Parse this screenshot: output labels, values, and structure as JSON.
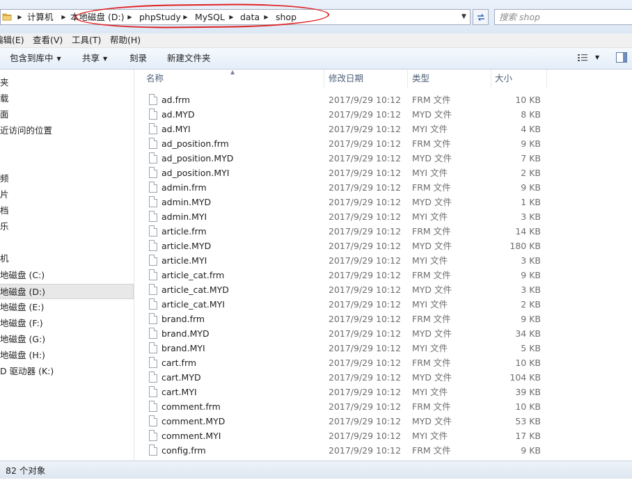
{
  "address_bar": {
    "crumbs": [
      "计算机",
      "本地磁盘 (D:)",
      "phpStudy",
      "MySQL",
      "data",
      "shop"
    ]
  },
  "search": {
    "placeholder": "搜索 shop"
  },
  "menu": [
    "编辑(E)",
    "查看(V)",
    "工具(T)",
    "帮助(H)"
  ],
  "toolbar": {
    "include_library": "包含到库中",
    "share": "共享",
    "burn": "刻录",
    "new_folder": "新建文件夹"
  },
  "nav_pane": {
    "items": [
      "夹",
      "载",
      "面",
      "近访问的位置",
      "",
      "",
      "频",
      "片",
      "档",
      "乐",
      "",
      "机",
      "地磁盘 (C:)",
      "地磁盘 (D:)",
      "地磁盘 (E:)",
      "地磁盘 (F:)",
      "地磁盘 (G:)",
      "地磁盘 (H:)",
      "D 驱动器 (K:)"
    ],
    "selected_index": 13
  },
  "columns": {
    "name": "名称",
    "date": "修改日期",
    "type": "类型",
    "size": "大小"
  },
  "files": [
    {
      "name": "ad.frm",
      "date": "2017/9/29 10:12",
      "type": "FRM 文件",
      "size": "10 KB"
    },
    {
      "name": "ad.MYD",
      "date": "2017/9/29 10:12",
      "type": "MYD 文件",
      "size": "8 KB"
    },
    {
      "name": "ad.MYI",
      "date": "2017/9/29 10:12",
      "type": "MYI 文件",
      "size": "4 KB"
    },
    {
      "name": "ad_position.frm",
      "date": "2017/9/29 10:12",
      "type": "FRM 文件",
      "size": "9 KB"
    },
    {
      "name": "ad_position.MYD",
      "date": "2017/9/29 10:12",
      "type": "MYD 文件",
      "size": "7 KB"
    },
    {
      "name": "ad_position.MYI",
      "date": "2017/9/29 10:12",
      "type": "MYI 文件",
      "size": "2 KB"
    },
    {
      "name": "admin.frm",
      "date": "2017/9/29 10:12",
      "type": "FRM 文件",
      "size": "9 KB"
    },
    {
      "name": "admin.MYD",
      "date": "2017/9/29 10:12",
      "type": "MYD 文件",
      "size": "1 KB"
    },
    {
      "name": "admin.MYI",
      "date": "2017/9/29 10:12",
      "type": "MYI 文件",
      "size": "3 KB"
    },
    {
      "name": "article.frm",
      "date": "2017/9/29 10:12",
      "type": "FRM 文件",
      "size": "14 KB"
    },
    {
      "name": "article.MYD",
      "date": "2017/9/29 10:12",
      "type": "MYD 文件",
      "size": "180 KB"
    },
    {
      "name": "article.MYI",
      "date": "2017/9/29 10:12",
      "type": "MYI 文件",
      "size": "3 KB"
    },
    {
      "name": "article_cat.frm",
      "date": "2017/9/29 10:12",
      "type": "FRM 文件",
      "size": "9 KB"
    },
    {
      "name": "article_cat.MYD",
      "date": "2017/9/29 10:12",
      "type": "MYD 文件",
      "size": "3 KB"
    },
    {
      "name": "article_cat.MYI",
      "date": "2017/9/29 10:12",
      "type": "MYI 文件",
      "size": "2 KB"
    },
    {
      "name": "brand.frm",
      "date": "2017/9/29 10:12",
      "type": "FRM 文件",
      "size": "9 KB"
    },
    {
      "name": "brand.MYD",
      "date": "2017/9/29 10:12",
      "type": "MYD 文件",
      "size": "34 KB"
    },
    {
      "name": "brand.MYI",
      "date": "2017/9/29 10:12",
      "type": "MYI 文件",
      "size": "5 KB"
    },
    {
      "name": "cart.frm",
      "date": "2017/9/29 10:12",
      "type": "FRM 文件",
      "size": "10 KB"
    },
    {
      "name": "cart.MYD",
      "date": "2017/9/29 10:12",
      "type": "MYD 文件",
      "size": "104 KB"
    },
    {
      "name": "cart.MYI",
      "date": "2017/9/29 10:12",
      "type": "MYI 文件",
      "size": "39 KB"
    },
    {
      "name": "comment.frm",
      "date": "2017/9/29 10:12",
      "type": "FRM 文件",
      "size": "10 KB"
    },
    {
      "name": "comment.MYD",
      "date": "2017/9/29 10:12",
      "type": "MYD 文件",
      "size": "53 KB"
    },
    {
      "name": "comment.MYI",
      "date": "2017/9/29 10:12",
      "type": "MYI 文件",
      "size": "17 KB"
    },
    {
      "name": "config.frm",
      "date": "2017/9/29 10:12",
      "type": "FRM 文件",
      "size": "9 KB"
    }
  ],
  "status": {
    "count_text": "82 个对象"
  },
  "colors": {
    "annotation": "#e02020",
    "toolbar_bg": "#e4edf8",
    "header_text": "#4c607a"
  }
}
